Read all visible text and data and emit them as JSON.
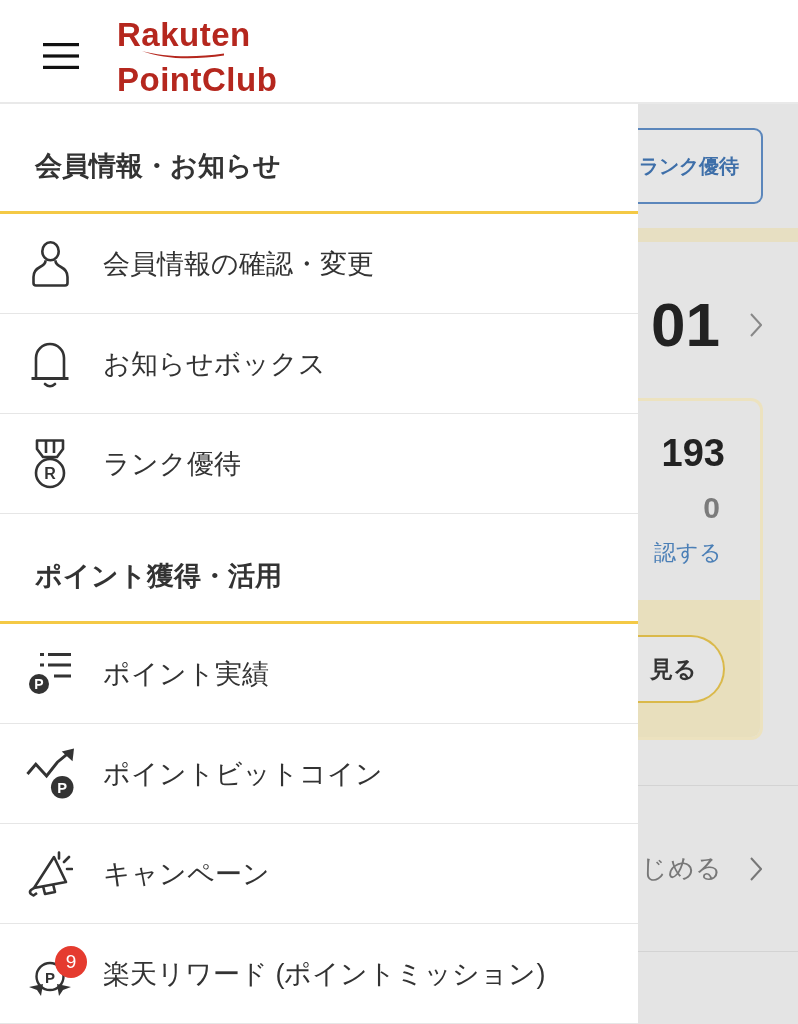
{
  "header": {
    "logo": {
      "line_1": "Rakuten",
      "line_2": "PointClub"
    }
  },
  "menu": {
    "sections": [
      {
        "title": "会員情報・お知らせ",
        "items": [
          {
            "label": "会員情報の確認・変更"
          },
          {
            "label": "お知らせボックス"
          },
          {
            "label": "ランク優待",
            "icon_text": "R"
          }
        ]
      },
      {
        "title": "ポイント獲得・活用",
        "items": [
          {
            "label": "ポイント実績",
            "icon_text": "P"
          },
          {
            "label": "ポイントビットコイン",
            "icon_text": "P"
          },
          {
            "label": "キャンペーン"
          },
          {
            "label": "楽天リワード (ポイントミッション)",
            "icon_text": "P",
            "badge": "9"
          }
        ]
      }
    ]
  },
  "page_behind": {
    "rank_button": "ランク優待",
    "big_number": "01",
    "card": {
      "value_1": "193",
      "value_2": "0",
      "link": "認する",
      "button": "見る"
    },
    "list_row": "じめる"
  }
}
